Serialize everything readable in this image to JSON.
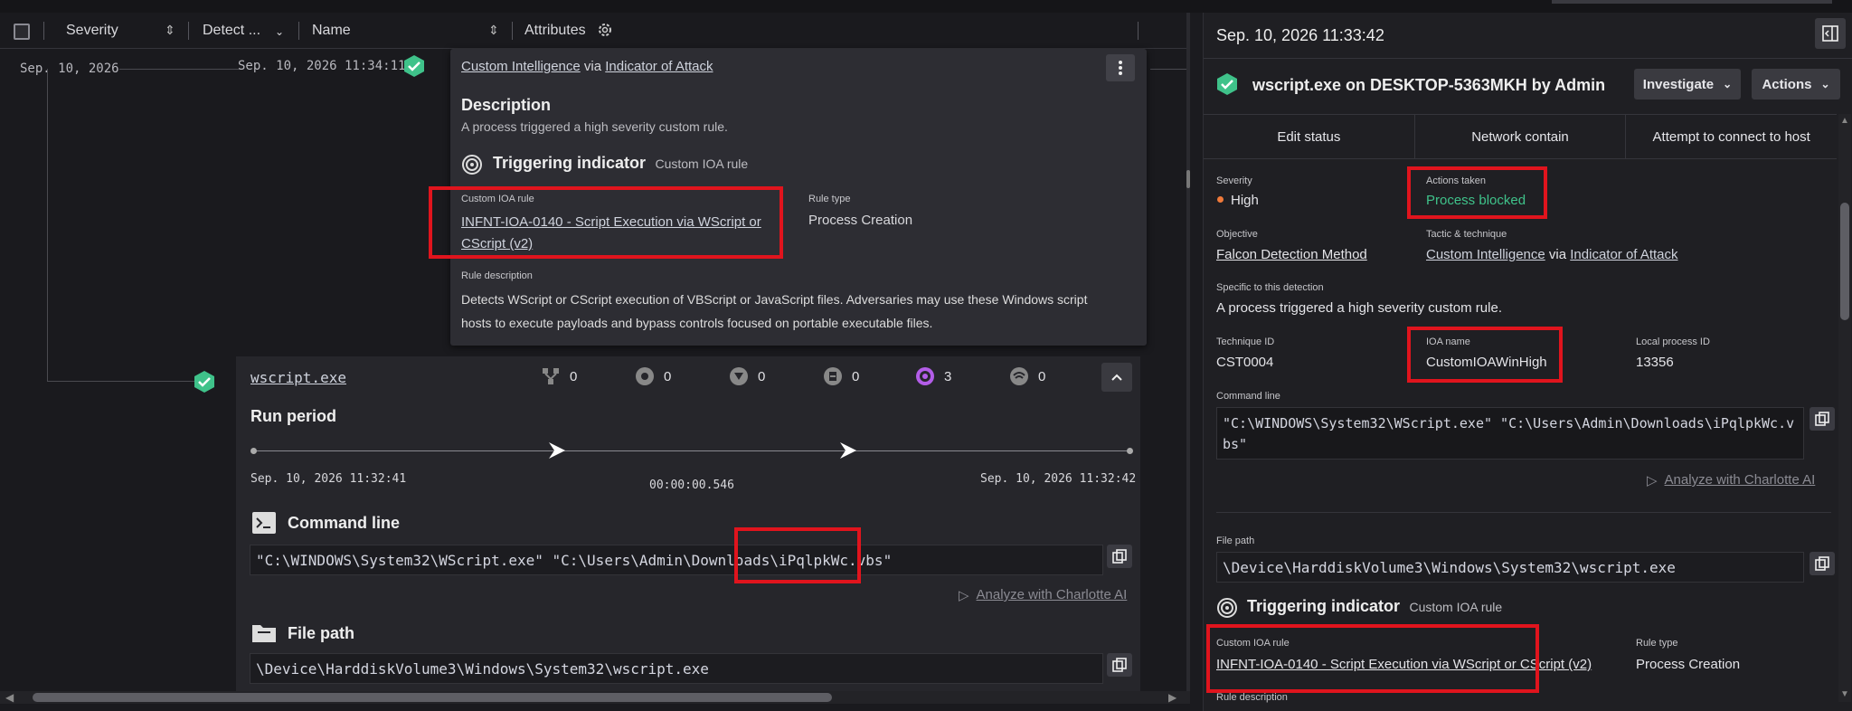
{
  "left": {
    "columns": {
      "severity": "Severity",
      "detect": "Detect ...",
      "name": "Name",
      "attributes": "Attributes"
    },
    "date_left": "Sep. 10, 2026",
    "date_node": "Sep. 10, 2026 11:34:11",
    "popup": {
      "tactic_link": "Custom Intelligence",
      "via": "via",
      "technique_link": "Indicator of Attack",
      "desc_heading": "Description",
      "desc_text": "A process triggered a high severity custom rule.",
      "trig_heading": "Triggering indicator",
      "trig_sub": "Custom IOA rule",
      "rule_label": "Custom IOA rule",
      "rule_line1": "INFNT-IOA-0140 - Script Execution via WScript or",
      "rule_line2": "CScript (v2)",
      "ruletype_label": "Rule type",
      "ruletype_value": "Process Creation",
      "ruledesc_label": "Rule description",
      "ruledesc_line1": "Detects WScript or CScript execution of VBScript or JavaScript files. Adversaries may use these Windows script",
      "ruledesc_line2": "hosts to execute payloads and bypass controls focused on portable executable files."
    },
    "card": {
      "process": "wscript.exe",
      "stats": [
        "0",
        "0",
        "0",
        "0",
        "3",
        "0"
      ],
      "run_period": "Run period",
      "start": "Sep. 10, 2026 11:32:41",
      "duration": "00:00:00.546",
      "end": "Sep. 10, 2026 11:32:42",
      "cmd_heading": "Command line",
      "cmd": "\"C:\\WINDOWS\\System32\\WScript.exe\" \"C:\\Users\\Admin\\Downloads\\iPqlpkWc.vbs\"",
      "analyze": "Analyze with Charlotte AI",
      "filepath_heading": "File path",
      "filepath": "\\Device\\HarddiskVolume3\\Windows\\System32\\wscript.exe"
    }
  },
  "right": {
    "timestamp": "Sep. 10, 2026 11:33:42",
    "title": "wscript.exe on DESKTOP-5363MKH by Admin",
    "investigate": "Investigate",
    "actions": "Actions",
    "actbar": [
      "Edit status",
      "Network contain",
      "Attempt to connect to host"
    ],
    "severity_label": "Severity",
    "severity_value": "High",
    "actions_taken_label": "Actions taken",
    "actions_taken_value": "Process blocked",
    "objective_label": "Objective",
    "objective_value": "Falcon Detection Method",
    "tactic_label": "Tactic & technique",
    "tactic_value": "Custom Intelligence",
    "via": "via",
    "technique_value": "Indicator of Attack",
    "specific_label": "Specific to this detection",
    "specific_value": "A process triggered a high severity custom rule.",
    "technique_id_label": "Technique ID",
    "technique_id_value": "CST0004",
    "ioa_label": "IOA name",
    "ioa_value": "CustomIOAWinHigh",
    "pid_label": "Local process ID",
    "pid_value": "13356",
    "cmd_label": "Command line",
    "cmd_line1": "\"C:\\WINDOWS\\System32\\WScript.exe\" \"C:\\Users\\Admin\\Downloads\\iPqlpkWc.v",
    "cmd_line2": "bs\"",
    "analyze": "Analyze with Charlotte AI",
    "filepath_label": "File path",
    "filepath": "\\Device\\HarddiskVolume3\\Windows\\System32\\wscript.exe",
    "trig_heading": "Triggering indicator",
    "trig_sub": "Custom IOA rule",
    "rule_label": "Custom IOA rule",
    "rule_value": "INFNT-IOA-0140 - Script Execution via WScript or CScript (v2)",
    "ruletype_label": "Rule type",
    "ruletype_value": "Process Creation",
    "ruledesc_label": "Rule description"
  },
  "colors": {
    "accent_red": "#e0141d",
    "success_green": "#3fc28a",
    "severity_orange": "#f07a3a",
    "purple": "#b35de8"
  }
}
